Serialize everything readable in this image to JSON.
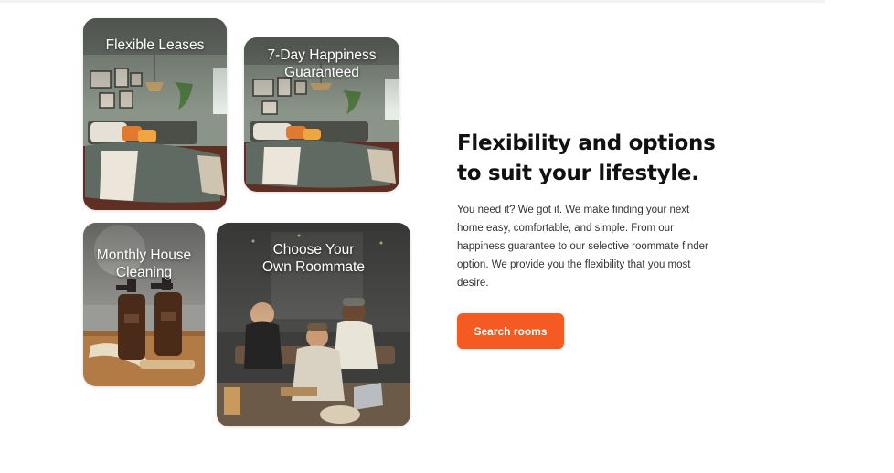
{
  "features": [
    {
      "label": "Flexible Leases",
      "image": "bedroom-photo"
    },
    {
      "label": "7-Day Happiness\nGuaranteed",
      "image": "bedroom-photo"
    },
    {
      "label": "Monthly House\nCleaning",
      "image": "cleaning-bottles-photo"
    },
    {
      "label": "Choose Your\nOwn Roommate",
      "image": "roommates-photo"
    }
  ],
  "section": {
    "heading": "Flexibility and options to suit your lifestyle.",
    "body": "You need it? We got it. We make finding your next home easy, comfortable, and simple. From our happiness guarantee to our selective roommate finder option. We provide you the flexibility that you most desire.",
    "cta_label": "Search rooms"
  },
  "colors": {
    "accent": "#f55a22",
    "heading": "#111111",
    "body": "#333333"
  }
}
